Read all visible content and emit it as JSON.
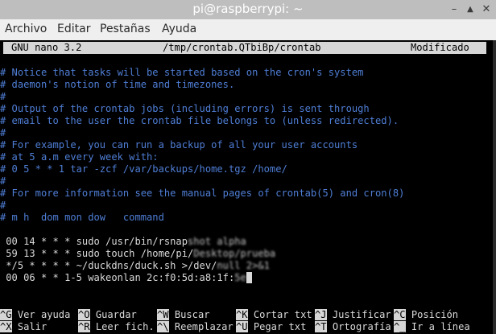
{
  "window": {
    "title": "pi@raspberrypi: ~",
    "buttons": {
      "minimize": "–",
      "maximize": "▲",
      "close": "✕"
    }
  },
  "menubar": {
    "items": [
      "Archivo",
      "Editar",
      "Pestañas",
      "Ayuda"
    ]
  },
  "nano": {
    "version": "GNU nano 3.2",
    "file": "/tmp/crontab.QTbiBp/crontab",
    "status": "Modificado"
  },
  "lines": [
    "# Notice that tasks will be started based on the cron's system",
    "# daemon's notion of time and timezones.",
    "#",
    "# Output of the crontab jobs (including errors) is sent through",
    "# email to the user the crontab file belongs to (unless redirected).",
    "#",
    "# For example, you can run a backup of all your user accounts",
    "# at 5 a.m every week with:",
    "# 0 5 * * 1 tar -zcf /var/backups/home.tgz /home/",
    "#",
    "# For more information see the manual pages of crontab(5) and cron(8)",
    "#",
    "# m h  dom mon dow   command"
  ],
  "jobs": [
    {
      "text": " 00 14 * * * sudo /usr/bin/rsnap",
      "hidden": "shot alpha"
    },
    {
      "text": " 59 13 * * * sudo touch /home/pi/",
      "hidden": "Desktop/prueba"
    },
    {
      "text": " */5 * * * * ~/duckdns/duck.sh >/dev/",
      "hidden": "null 2>&1"
    },
    {
      "text": " 00 06 * * 1-5 wakeonlan 2c:f0:5d:a8:1f:",
      "hidden": "5e"
    }
  ],
  "shortcuts": [
    {
      "key": "^G",
      "label": "Ver ayuda"
    },
    {
      "key": "^O",
      "label": "Guardar"
    },
    {
      "key": "^W",
      "label": "Buscar"
    },
    {
      "key": "^K",
      "label": "Cortar txt"
    },
    {
      "key": "^J",
      "label": "Justificar"
    },
    {
      "key": "^C",
      "label": "Posición"
    },
    {
      "key": "^X",
      "label": "Salir"
    },
    {
      "key": "^R",
      "label": "Leer fich."
    },
    {
      "key": "^\\",
      "label": "Reemplazar"
    },
    {
      "key": "^U",
      "label": "Pegar txt"
    },
    {
      "key": "^T",
      "label": "Ortografía"
    },
    {
      "key": "^_",
      "label": "Ir a línea"
    }
  ],
  "colors": {
    "comment": "#4f7ed6",
    "terminal_bg": "#000000",
    "header_bg": "#d6d6d6"
  }
}
